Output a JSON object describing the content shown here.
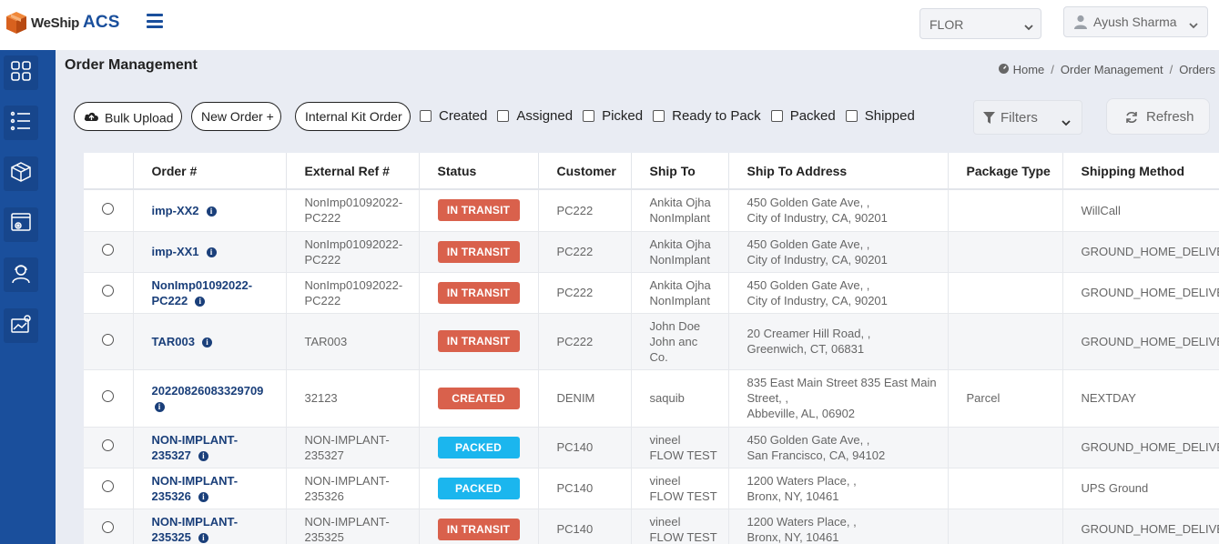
{
  "brand": {
    "name_a": "WeShip",
    "name_b": "ACS"
  },
  "header": {
    "warehouse": "FLOR",
    "user": "Ayush Sharma"
  },
  "sidebar": {
    "items": [
      {
        "icon": "dashboard-grid-icon"
      },
      {
        "icon": "list-icon"
      },
      {
        "icon": "box-icon"
      },
      {
        "icon": "settings-window-icon"
      },
      {
        "icon": "support-agent-icon"
      },
      {
        "icon": "map-location-icon"
      }
    ]
  },
  "page": {
    "title": "Order Management",
    "breadcrumb": [
      "Home",
      "Order Management",
      "Orders"
    ]
  },
  "toolbar": {
    "bulk_upload": "Bulk Upload",
    "new_order": "New Order +",
    "internal_kit": "Internal Kit Order",
    "status_filters": [
      "Created",
      "Assigned",
      "Picked",
      "Ready to Pack",
      "Packed",
      "Shipped"
    ],
    "filters_label": "Filters",
    "refresh_label": "Refresh"
  },
  "table": {
    "columns": [
      "",
      "Order #",
      "External Ref #",
      "Status",
      "Customer",
      "Ship To",
      "Ship To Address",
      "Package Type",
      "Shipping Method"
    ],
    "rows": [
      {
        "order": [
          "imp-XX2"
        ],
        "ext": [
          "NonImp01092022-",
          "PC222"
        ],
        "status": "IN TRANSIT",
        "status_kind": "transit",
        "customer": "PC222",
        "ship_to": [
          "Ankita Ojha",
          "NonImplant"
        ],
        "address": [
          "450 Golden Gate Ave, ,",
          "City of Industry, CA, 90201"
        ],
        "package": "",
        "method": "WillCall"
      },
      {
        "order": [
          "imp-XX1"
        ],
        "ext": [
          "NonImp01092022-",
          "PC222"
        ],
        "status": "IN TRANSIT",
        "status_kind": "transit",
        "customer": "PC222",
        "ship_to": [
          "Ankita Ojha",
          "NonImplant"
        ],
        "address": [
          "450 Golden Gate Ave, ,",
          "City of Industry, CA, 90201"
        ],
        "package": "",
        "method": "GROUND_HOME_DELIVER"
      },
      {
        "order": [
          "NonImp01092022-",
          "PC222"
        ],
        "ext": [
          "NonImp01092022-",
          "PC222"
        ],
        "status": "IN TRANSIT",
        "status_kind": "transit",
        "customer": "PC222",
        "ship_to": [
          "Ankita Ojha",
          "NonImplant"
        ],
        "address": [
          "450 Golden Gate Ave, ,",
          "City of Industry, CA, 90201"
        ],
        "package": "",
        "method": "GROUND_HOME_DELIVER"
      },
      {
        "order": [
          "TAR003"
        ],
        "ext": [
          "TAR003"
        ],
        "status": "IN TRANSIT",
        "status_kind": "transit",
        "customer": "PC222",
        "ship_to": [
          "John Doe",
          "John anc",
          "Co."
        ],
        "address": [
          "20 Creamer Hill Road, ,",
          "Greenwich, CT, 06831"
        ],
        "package": "",
        "method": "GROUND_HOME_DELIVER"
      },
      {
        "order": [
          "20220826083329709",
          ""
        ],
        "ext": [
          "32123"
        ],
        "status": "CREATED",
        "status_kind": "created",
        "customer": "DENIM",
        "ship_to": [
          "saquib"
        ],
        "address": [
          "835 East Main Street 835 East Main",
          "Street, ,",
          "Abbeville, AL, 06902"
        ],
        "package": "Parcel",
        "method": "NEXTDAY"
      },
      {
        "order": [
          "NON-IMPLANT-",
          "235327"
        ],
        "ext": [
          "NON-IMPLANT-",
          "235327"
        ],
        "status": "PACKED",
        "status_kind": "packed",
        "customer": "PC140",
        "ship_to": [
          "vineel",
          "FLOW TEST"
        ],
        "address": [
          "450 Golden Gate Ave, ,",
          "San Francisco, CA, 94102"
        ],
        "package": "",
        "method": "GROUND_HOME_DELIVER"
      },
      {
        "order": [
          "NON-IMPLANT-",
          "235326"
        ],
        "ext": [
          "NON-IMPLANT-",
          "235326"
        ],
        "status": "PACKED",
        "status_kind": "packed",
        "customer": "PC140",
        "ship_to": [
          "vineel",
          "FLOW TEST"
        ],
        "address": [
          "1200 Waters Place, ,",
          "Bronx, NY, 10461"
        ],
        "package": "",
        "method": "UPS Ground"
      },
      {
        "order": [
          "NON-IMPLANT-",
          "235325"
        ],
        "ext": [
          "NON-IMPLANT-",
          "235325"
        ],
        "status": "IN TRANSIT",
        "status_kind": "transit",
        "customer": "PC140",
        "ship_to": [
          "vineel",
          "FLOW TEST"
        ],
        "address": [
          "1200 Waters Place, ,",
          "Bronx, NY, 10461"
        ],
        "package": "",
        "method": "GROUND_HOME_DELIVER"
      }
    ]
  }
}
